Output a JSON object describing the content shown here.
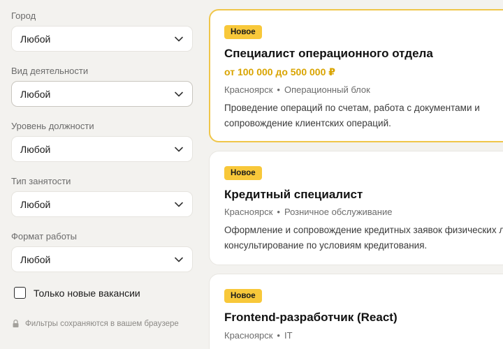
{
  "filters": {
    "city": {
      "label": "Город",
      "value": "Любой"
    },
    "activity": {
      "label": "Вид деятельности",
      "value": "Любой"
    },
    "level": {
      "label": "Уровень должности",
      "value": "Любой"
    },
    "employment": {
      "label": "Тип занятости",
      "value": "Любой"
    },
    "work_format": {
      "label": "Формат работы",
      "value": "Любой"
    },
    "only_new": {
      "label": "Только новые вакансии",
      "checked": false
    },
    "hint": "Фильтры сохраняются в вашем браузере"
  },
  "icons": {
    "select": "chevron-down-icon",
    "hint": "lock-icon"
  },
  "colors": {
    "badge": "#f8c83a",
    "salary": "#d9a400",
    "highlight_border": "#f0c64a",
    "background": "#f3f2ef"
  },
  "jobs": [
    {
      "badge": "Новое",
      "title": "Специалист операционного отдела",
      "salary": "от 100 000 до 500 000 ₽",
      "city": "Красноярск",
      "separator": "•",
      "department": "Операционный блок",
      "desc_line1": "Проведение операций по счетам, работа с документами и",
      "desc_line2": "сопровождение клиентских операций."
    },
    {
      "badge": "Новое",
      "title": "Кредитный специалист",
      "city": "Красноярск",
      "separator": "•",
      "department": "Розничное обслуживание",
      "desc_line1": "Оформление и сопровождение кредитных заявок физических л",
      "desc_line2": "консультирование по условиям кредитования."
    },
    {
      "badge": "Новое",
      "title": "Frontend-разработчик (React)",
      "city": "Красноярск",
      "separator": "•",
      "department": "IT"
    }
  ]
}
